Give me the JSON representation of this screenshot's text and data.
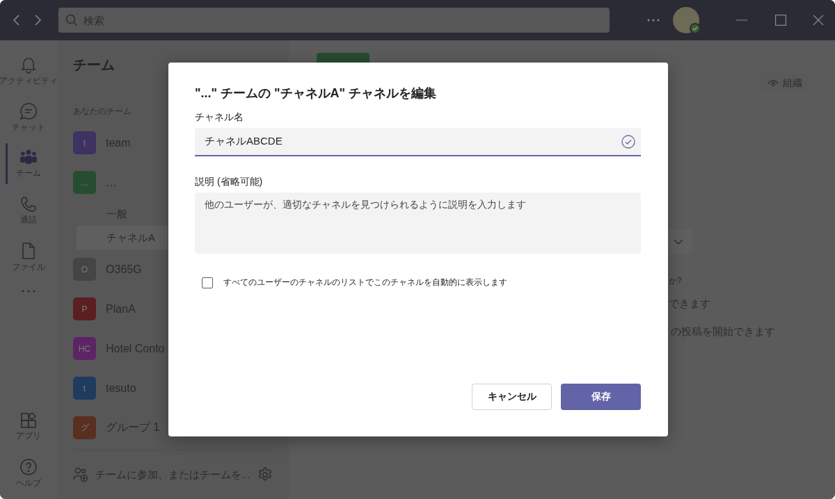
{
  "titlebar": {
    "search_placeholder": "検索"
  },
  "rail": {
    "items": [
      {
        "kind": "bell",
        "label": "アクティビティ",
        "selected": false
      },
      {
        "kind": "chat",
        "label": "チャット",
        "selected": false
      },
      {
        "kind": "teams",
        "label": "チーム",
        "selected": true
      },
      {
        "kind": "phone",
        "label": "通話",
        "selected": false
      },
      {
        "kind": "file",
        "label": "ファイル",
        "selected": false
      }
    ],
    "bottom_items": [
      {
        "kind": "apps",
        "label": "アプリ"
      },
      {
        "kind": "help",
        "label": "ヘルプ"
      }
    ]
  },
  "teams_panel": {
    "title": "チーム",
    "section": "あなたのチーム",
    "teams": [
      {
        "initials": "t",
        "name": "team",
        "color": "#3d3262"
      },
      {
        "initials": "…",
        "name": "…",
        "color": "#264d31",
        "channels": [
          {
            "name": "一般",
            "selected": false
          },
          {
            "name": "チャネルA",
            "selected": true
          }
        ]
      },
      {
        "initials": "O",
        "name": "O365G",
        "color": "#454545"
      },
      {
        "initials": "P",
        "name": "PlanA",
        "color": "#5b1f21"
      },
      {
        "initials": "HC",
        "name": "Hotel Conto",
        "color": "#5d2465"
      },
      {
        "initials": "t",
        "name": "tesuto",
        "color": "#1f3c5e"
      },
      {
        "initials": "グ",
        "name": "グループ 1",
        "color": "#59301f"
      }
    ],
    "footer": "チームに参加、またはチームを..."
  },
  "main": {
    "org_button": "組織",
    "fragments": [
      "か?",
      "できます",
      "の投稿を開始できます"
    ]
  },
  "dialog": {
    "title": "\"...\" チームの \"チャネルA\" チャネルを編集",
    "name_label": "チャネル名",
    "name_value": "チャネルABCDE",
    "description_label": "説明 (省略可能)",
    "description_placeholder": "他のユーザーが、適切なチャネルを見つけられるように説明を入力します",
    "checkbox": {
      "label": "すべてのユーザーのチャネルのリストでこのチャネルを自動的に表示します",
      "checked": false
    },
    "buttons": [
      {
        "kind": "secondary",
        "label": "キャンセル"
      },
      {
        "kind": "primary",
        "label": "保存"
      }
    ]
  }
}
